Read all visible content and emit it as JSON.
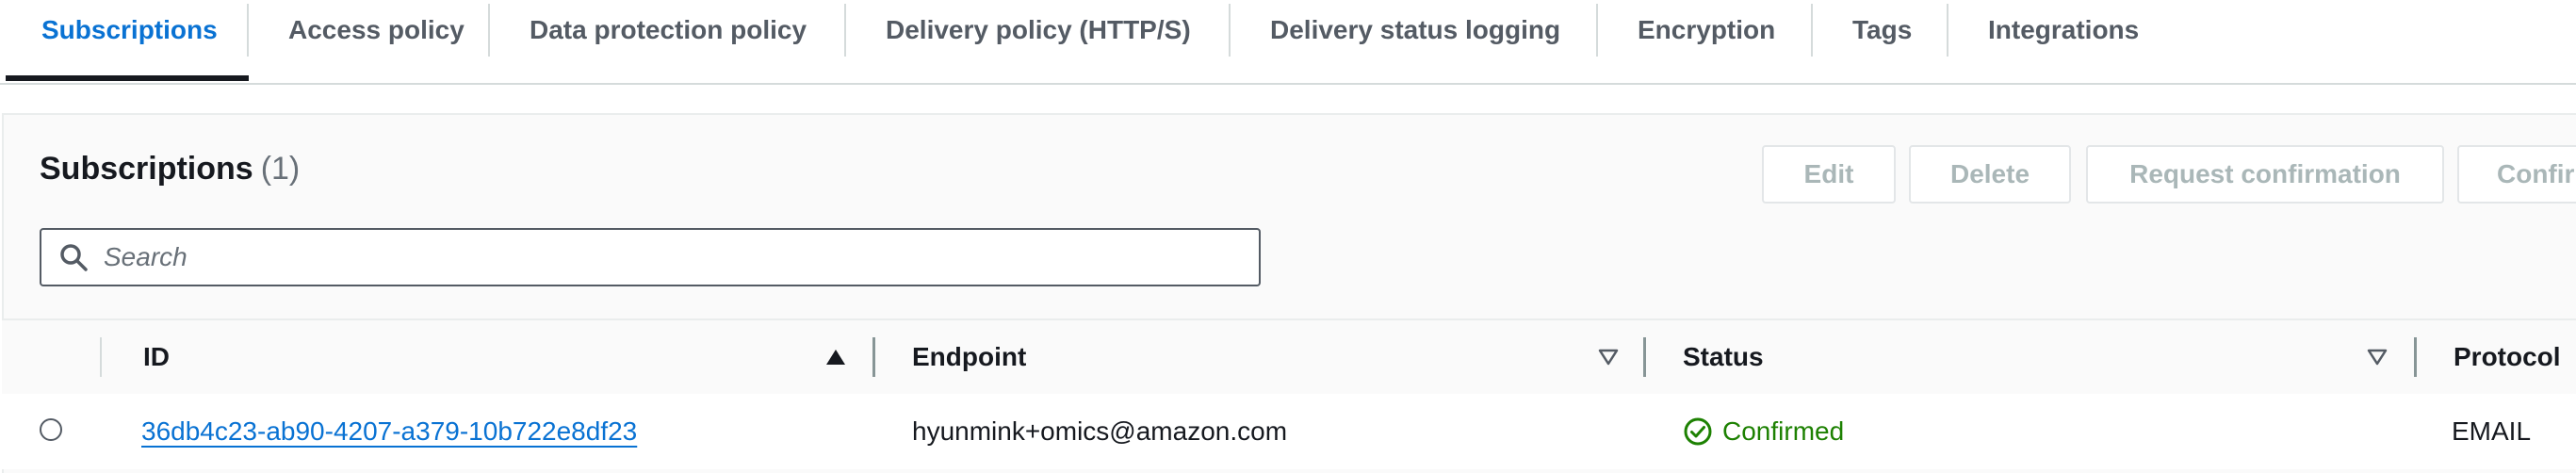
{
  "tabs": [
    {
      "label": "Subscriptions",
      "active": true
    },
    {
      "label": "Access policy"
    },
    {
      "label": "Data protection policy"
    },
    {
      "label": "Delivery policy (HTTP/S)"
    },
    {
      "label": "Delivery status logging"
    },
    {
      "label": "Encryption"
    },
    {
      "label": "Tags"
    },
    {
      "label": "Integrations"
    }
  ],
  "panel": {
    "title": "Subscriptions",
    "count": "(1)",
    "buttons": {
      "edit": "Edit",
      "delete": "Delete",
      "request_confirmation": "Request confirmation",
      "confirm": "Confirm subscription"
    }
  },
  "search": {
    "placeholder": "Search",
    "value": "",
    "icon": "search-icon"
  },
  "table": {
    "columns": [
      "ID",
      "Endpoint",
      "Status",
      "Protocol"
    ],
    "rows": [
      {
        "id": "36db4c23-ab90-4207-a379-10b722e8df23",
        "endpoint": "hyunmink+omics@amazon.com",
        "status": "Confirmed",
        "protocol": "EMAIL"
      }
    ]
  },
  "colors": {
    "accent": "#0972d3",
    "success": "#1d8102",
    "disabled": "#aab7b8",
    "text": "#16191f"
  }
}
